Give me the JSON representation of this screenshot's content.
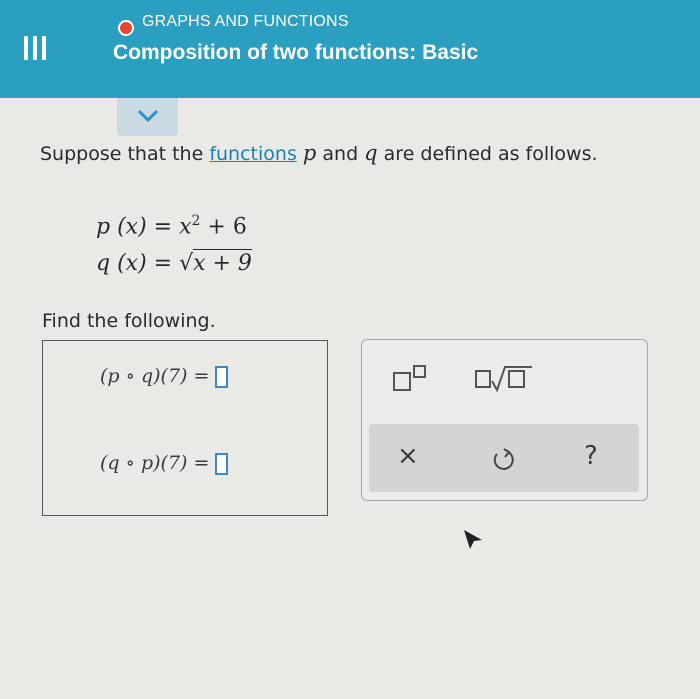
{
  "header": {
    "topic": "GRAPHS AND FUNCTIONS",
    "lesson": "Composition of two functions: Basic",
    "status_color": "#e8462c",
    "accent_color": "#2a9fbf"
  },
  "intro": {
    "prefix": "Suppose that the ",
    "link": "functions",
    "var_p": "p",
    "mid": " and ",
    "var_q": "q",
    "suffix": " are defined as follows."
  },
  "definitions": {
    "p_lhs": "p (x) = x",
    "p_exp": "2",
    "p_rhs": " + 6",
    "q_lhs": "q (x) = ",
    "q_radicand": "x + 9"
  },
  "find_label": "Find the following.",
  "answers": [
    {
      "expr": "(p ∘ q)(7) =",
      "value": ""
    },
    {
      "expr": "(q ∘ p)(7) =",
      "value": ""
    }
  ],
  "palette": {
    "exponent_icon": "exponent-template-icon",
    "nth_root_icon": "nth-root-template-icon",
    "clear_label": "×",
    "undo_icon": "undo-icon",
    "help_label": "?"
  }
}
